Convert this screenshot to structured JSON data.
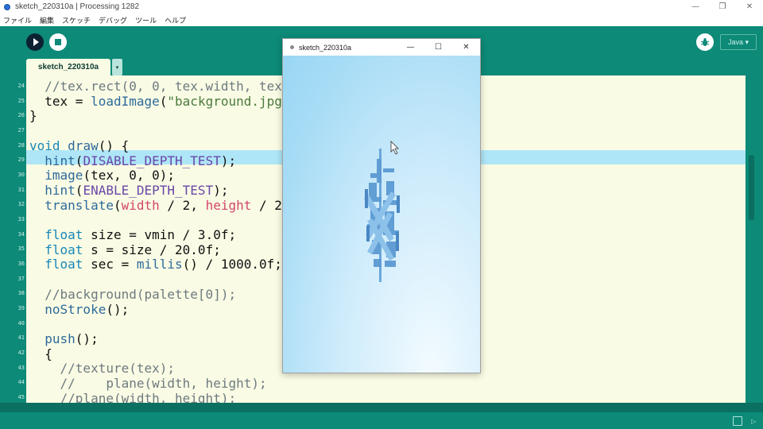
{
  "window": {
    "title": "sketch_220310a | Processing 1282"
  },
  "menu": {
    "items": [
      "ファイル",
      "編集",
      "スケッチ",
      "デバッグ",
      "ツール",
      "ヘルプ"
    ]
  },
  "toolbar": {
    "mode_label": "Java ▾"
  },
  "tabs": {
    "active": "sketch_220310a",
    "menu_glyph": "▾"
  },
  "editor": {
    "line_numbers": [
      "24",
      "25",
      "26",
      "27",
      "28",
      "29",
      "30",
      "31",
      "32",
      "33",
      "34",
      "35",
      "36",
      "37",
      "38",
      "39",
      "40",
      "41",
      "42",
      "43",
      "44",
      "45"
    ],
    "highlighted_line": "29"
  },
  "sketch_window": {
    "title": "sketch_220310a"
  },
  "colors": {
    "accent": "#0d8a78",
    "editor_bg": "#f9fbe4",
    "highlight": "#aee6f7"
  }
}
